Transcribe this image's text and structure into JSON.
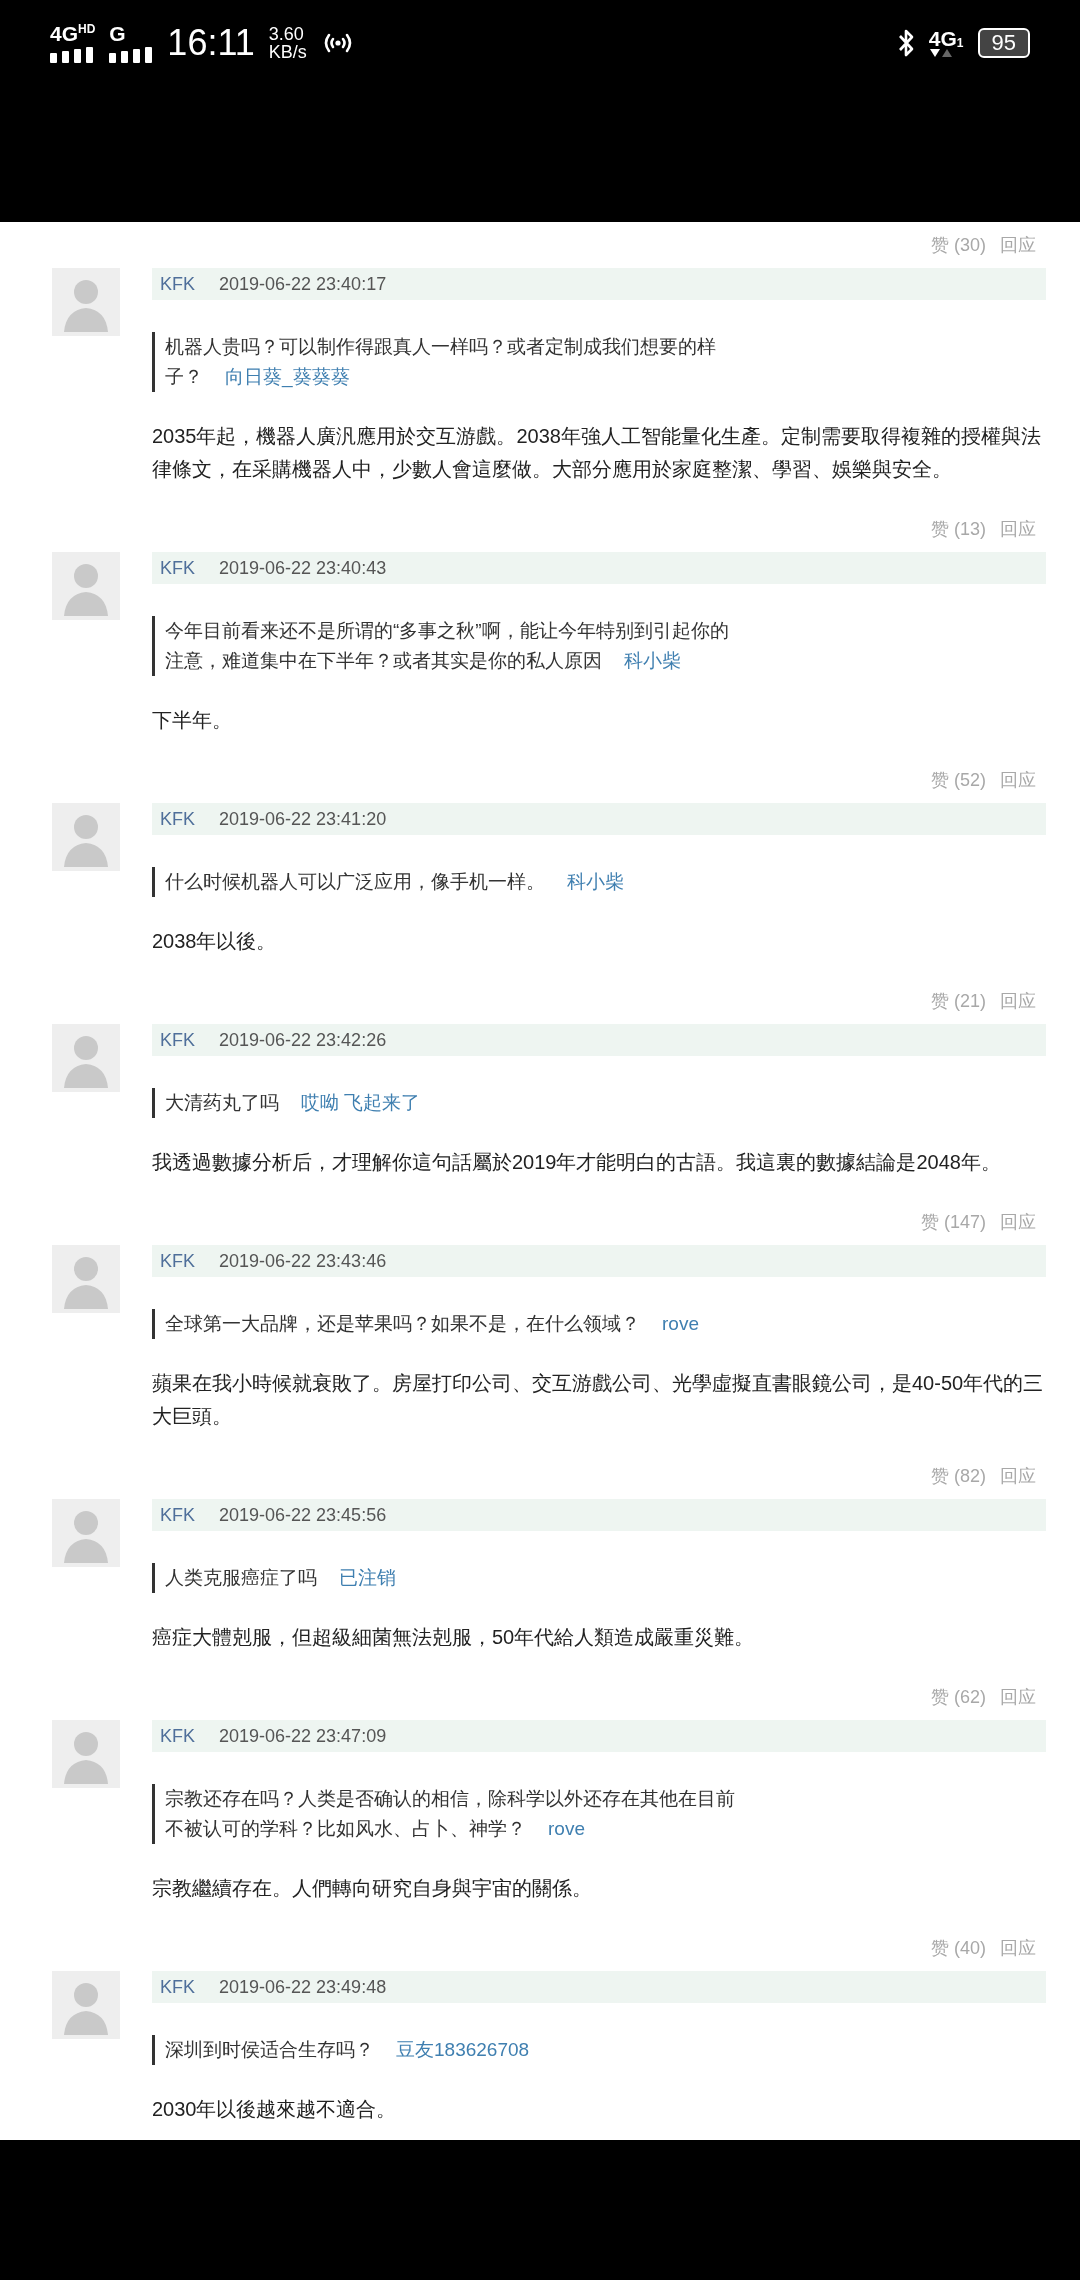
{
  "status_bar": {
    "network_1": "4G",
    "network_1_badge": "HD",
    "network_2": "G",
    "time": "16:11",
    "speed_value": "3.60",
    "speed_unit": "KB/s",
    "network_3": "4G",
    "network_3_badge": "1",
    "battery": "95"
  },
  "top_actions": {
    "likes": "赞 (30)",
    "reply": "回应"
  },
  "comments": [
    {
      "author": "KFK",
      "date": "2019-06-22 23:40:17",
      "quote": "机器人贵吗？可以制作得跟真人一样吗？或者定制成我们想要的样子？",
      "quote_author": "向日葵_葵葵葵",
      "answer": "2035年起，機器人廣汎應用於交互游戲。2038年強人工智能量化生產。定制需要取得複雜的授權與法律條文，在采購機器人中，少數人會這麼做。大部分應用於家庭整潔、學習、娛樂與安全。",
      "likes": "赞 (13)",
      "reply": "回应"
    },
    {
      "author": "KFK",
      "date": "2019-06-22 23:40:43",
      "quote": "今年目前看来还不是所谓的“多事之秋”啊，能让今年特别到引起你的注意，难道集中在下半年？或者其实是你的私人原因",
      "quote_author": "科小柴",
      "answer": "下半年。",
      "likes": "赞 (52)",
      "reply": "回应"
    },
    {
      "author": "KFK",
      "date": "2019-06-22 23:41:20",
      "quote": "什么时候机器人可以广泛应用，像手机一样。",
      "quote_author": "科小柴",
      "answer": "2038年以後。",
      "likes": "赞 (21)",
      "reply": "回应"
    },
    {
      "author": "KFK",
      "date": "2019-06-22 23:42:26",
      "quote": "大清药丸了吗",
      "quote_author": "哎呦 飞起来了",
      "answer": "我透過數據分析后，才理解你這句話屬於2019年才能明白的古語。我這裏的數據結論是2048年。",
      "likes": "赞 (147)",
      "reply": "回应"
    },
    {
      "author": "KFK",
      "date": "2019-06-22 23:43:46",
      "quote": "全球第一大品牌，还是苹果吗？如果不是，在什么领域？",
      "quote_author": "rove",
      "answer": "蘋果在我小時候就衰敗了。房屋打印公司、交互游戲公司、光學虛擬直書眼鏡公司，是40-50年代的三大巨頭。",
      "likes": "赞 (82)",
      "reply": "回应"
    },
    {
      "author": "KFK",
      "date": "2019-06-22 23:45:56",
      "quote": "人类克服癌症了吗",
      "quote_author": "已注销",
      "answer": "癌症大體剋服，但超級細菌無法剋服，50年代給人類造成嚴重災難。",
      "likes": "赞 (62)",
      "reply": "回应"
    },
    {
      "author": "KFK",
      "date": "2019-06-22 23:47:09",
      "quote": "宗教还存在吗？人类是否确认的相信，除科学以外还存在其他在目前不被认可的学科？比如风水、占卜、神学？",
      "quote_author": "rove",
      "answer": "宗教繼續存在。人們轉向研究自身與宇宙的關係。",
      "likes": "赞 (40)",
      "reply": "回应"
    },
    {
      "author": "KFK",
      "date": "2019-06-22 23:49:48",
      "quote": "深圳到时侯适合生存吗？",
      "quote_author": "豆友183626708",
      "answer": "2030年以後越來越不適合。"
    }
  ]
}
